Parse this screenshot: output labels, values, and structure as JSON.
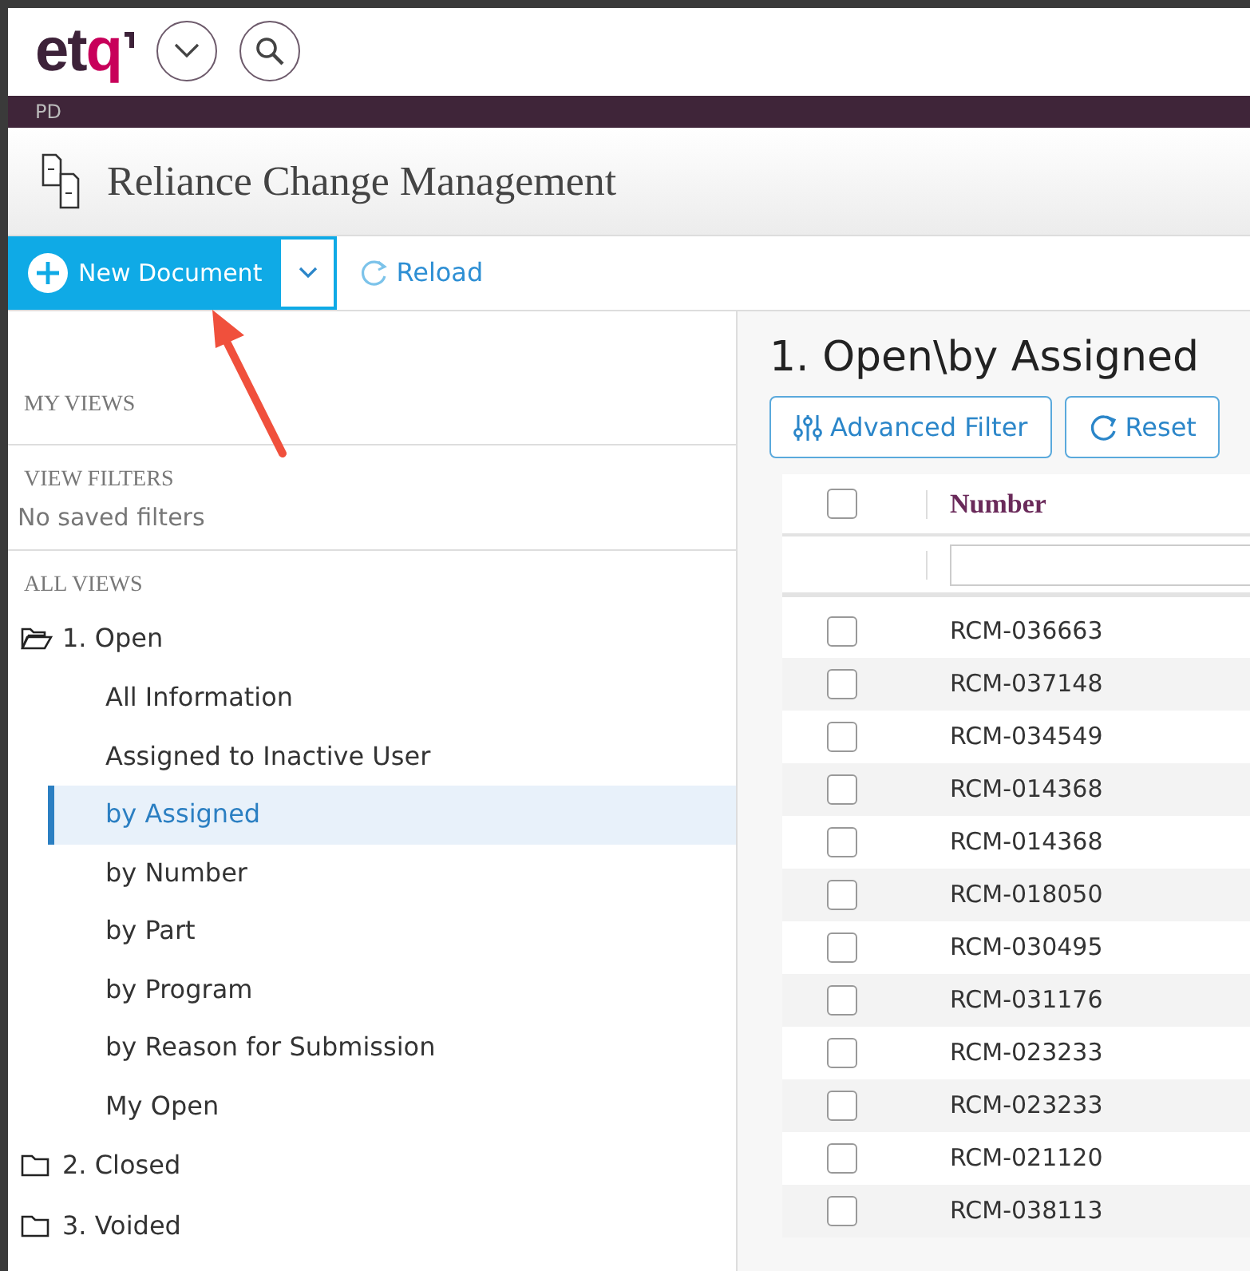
{
  "header": {
    "logo": "etq",
    "workspace": "PD"
  },
  "app_title": "Reliance Change Management",
  "toolbar": {
    "new_button": "New Document",
    "reload_button": "Reload"
  },
  "sidebar": {
    "my_views": {
      "heading": "MY VIEWS"
    },
    "view_filters": {
      "heading": "VIEW FILTERS",
      "empty_text": "No saved filters"
    },
    "all_views": {
      "heading": "ALL VIEWS",
      "tree": [
        {
          "label": "1. Open",
          "expanded": true,
          "selected": false,
          "children": [
            {
              "label": "All Information",
              "selected": false
            },
            {
              "label": "Assigned to Inactive User",
              "selected": false
            },
            {
              "label": "by Assigned",
              "selected": true
            },
            {
              "label": "by Number",
              "selected": false
            },
            {
              "label": "by Part",
              "selected": false
            },
            {
              "label": "by Program",
              "selected": false
            },
            {
              "label": "by Reason for Submission",
              "selected": false
            },
            {
              "label": "My Open",
              "selected": false
            }
          ]
        },
        {
          "label": "2. Closed",
          "expanded": false,
          "selected": false
        },
        {
          "label": "3. Voided",
          "expanded": false,
          "selected": false
        }
      ]
    }
  },
  "view": {
    "title": "1. Open\\by Assigned",
    "buttons": [
      {
        "label": "Advanced Filter",
        "kind": "filter"
      },
      {
        "label": "Reset",
        "kind": "reset"
      }
    ],
    "table": {
      "columns": [
        "Number"
      ],
      "select_all_checked": false,
      "rows": [
        {
          "number": "RCM-036663",
          "checked": false
        },
        {
          "number": "RCM-037148",
          "checked": false
        },
        {
          "number": "RCM-034549",
          "checked": false
        },
        {
          "number": "RCM-014368",
          "checked": false
        },
        {
          "number": "RCM-014368",
          "checked": false
        },
        {
          "number": "RCM-018050",
          "checked": false
        },
        {
          "number": "RCM-030495",
          "checked": false
        },
        {
          "number": "RCM-031176",
          "checked": false
        },
        {
          "number": "RCM-023233",
          "checked": false
        },
        {
          "number": "RCM-023233",
          "checked": false
        },
        {
          "number": "RCM-021120",
          "checked": false
        },
        {
          "number": "RCM-038113",
          "checked": false
        }
      ]
    }
  }
}
